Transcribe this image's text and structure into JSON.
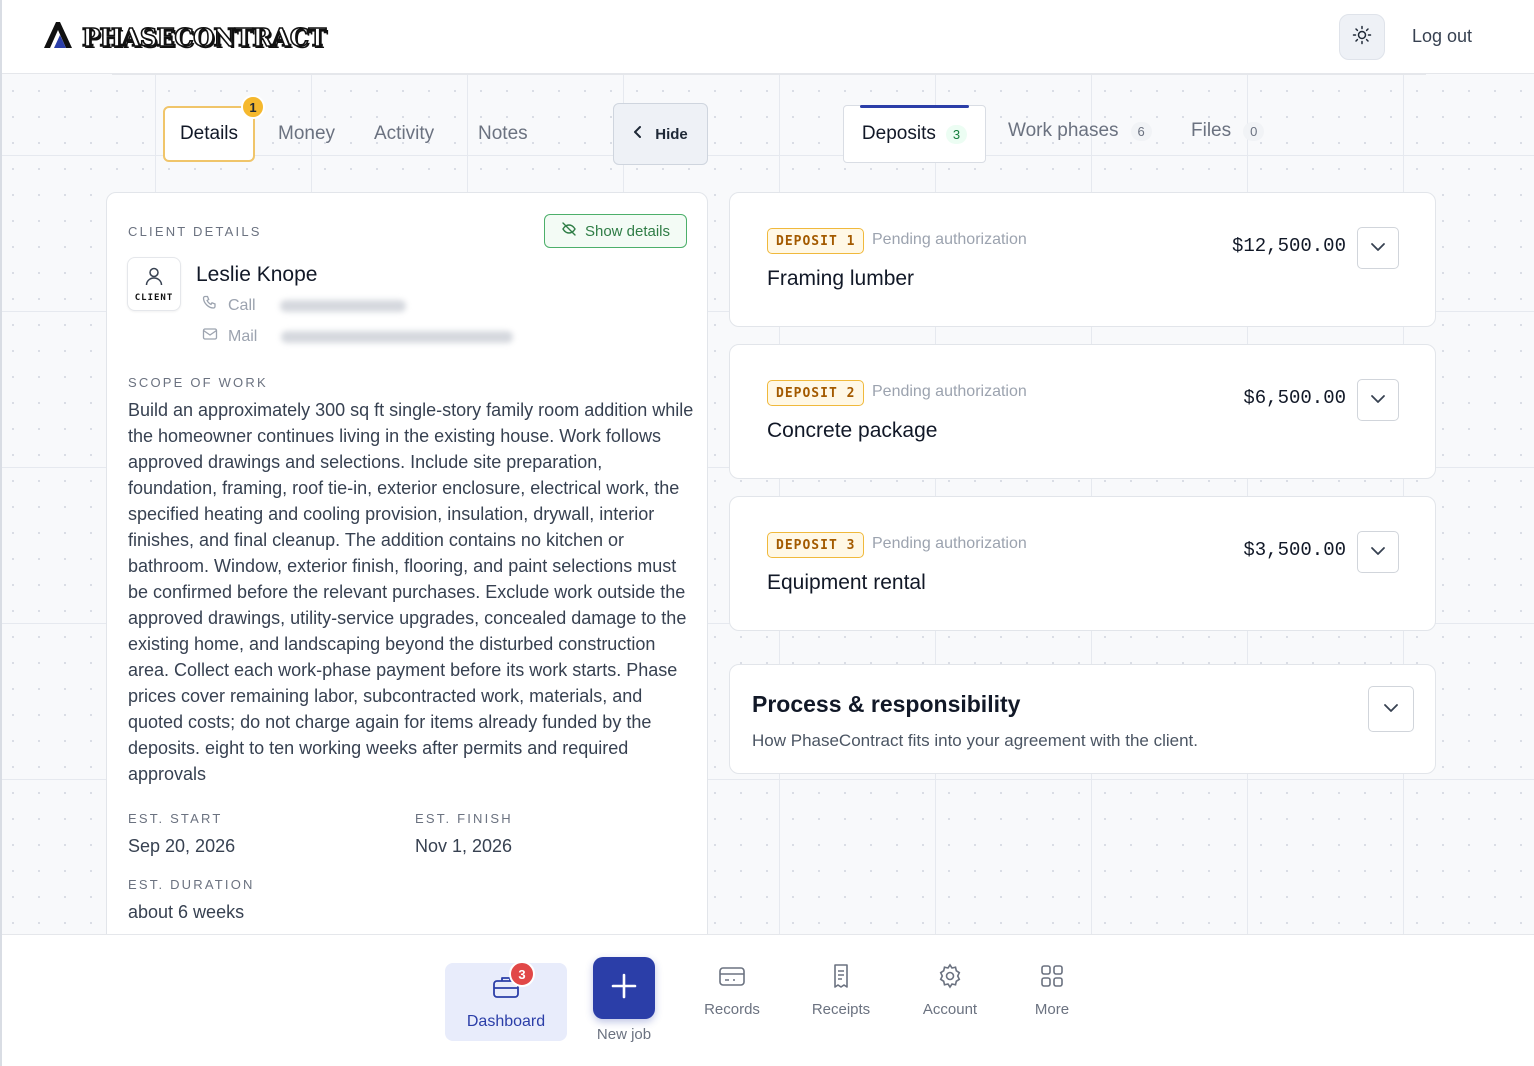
{
  "header": {
    "brand": "PHASECONTRACT",
    "logout_label": "Log out"
  },
  "left_tabs": {
    "details": "Details",
    "details_badge": "1",
    "money": "Money",
    "activity": "Activity",
    "notes": "Notes",
    "hide": "Hide"
  },
  "right_tabs": {
    "deposits": "Deposits",
    "deposits_count": "3",
    "work_phases": "Work phases",
    "work_phases_count": "6",
    "files": "Files",
    "files_count": "0"
  },
  "client": {
    "section_label": "CLIENT DETAILS",
    "show_details": "Show details",
    "avatar_label": "CLIENT",
    "name": "Leslie Knope",
    "call_label": "Call",
    "mail_label": "Mail",
    "scope_label": "SCOPE OF WORK",
    "scope_text": "Build an approximately 300 sq ft single-story family room addition while the homeowner continues living in the existing house. Work follows approved drawings and selections. Include site preparation, foundation, framing, roof tie-in, exterior enclosure, electrical work, the specified heating and cooling provision, insulation, drywall, interior finishes, and final cleanup. The addition contains no kitchen or bathroom. Window, exterior finish, flooring, and paint selections must be confirmed before the relevant purchases. Exclude work outside the approved drawings, utility-service upgrades, concealed damage to the existing home, and landscaping beyond the disturbed construction area. Collect each work-phase payment before its work starts. Phase prices cover remaining labor, subcontracted work, materials, and quoted costs; do not charge again for items already funded by the deposits. eight to ten working weeks after permits and required approvals",
    "est_start_label": "EST. START",
    "est_start": "Sep 20, 2026",
    "est_finish_label": "EST. FINISH",
    "est_finish": "Nov 1, 2026",
    "est_duration_label": "EST. DURATION",
    "est_duration": "about 6 weeks"
  },
  "deposits": [
    {
      "tag": "DEPOSIT 1",
      "status": "Pending authorization",
      "title": "Framing lumber",
      "amount": "$12,500.00"
    },
    {
      "tag": "DEPOSIT 2",
      "status": "Pending authorization",
      "title": "Concrete package",
      "amount": "$6,500.00"
    },
    {
      "tag": "DEPOSIT 3",
      "status": "Pending authorization",
      "title": "Equipment rental",
      "amount": "$3,500.00"
    }
  ],
  "process": {
    "title": "Process & responsibility",
    "subtitle": "How PhaseContract fits into your agreement with the client."
  },
  "bottom_nav": {
    "dashboard": "Dashboard",
    "dashboard_badge": "3",
    "new_job": "New job",
    "records": "Records",
    "receipts": "Receipts",
    "account": "Account",
    "more": "More"
  },
  "colors": {
    "accent": "#2b3ea8",
    "badge_amber": "#f5b82e",
    "badge_red": "#e14747",
    "success_green": "#4caf6a"
  }
}
